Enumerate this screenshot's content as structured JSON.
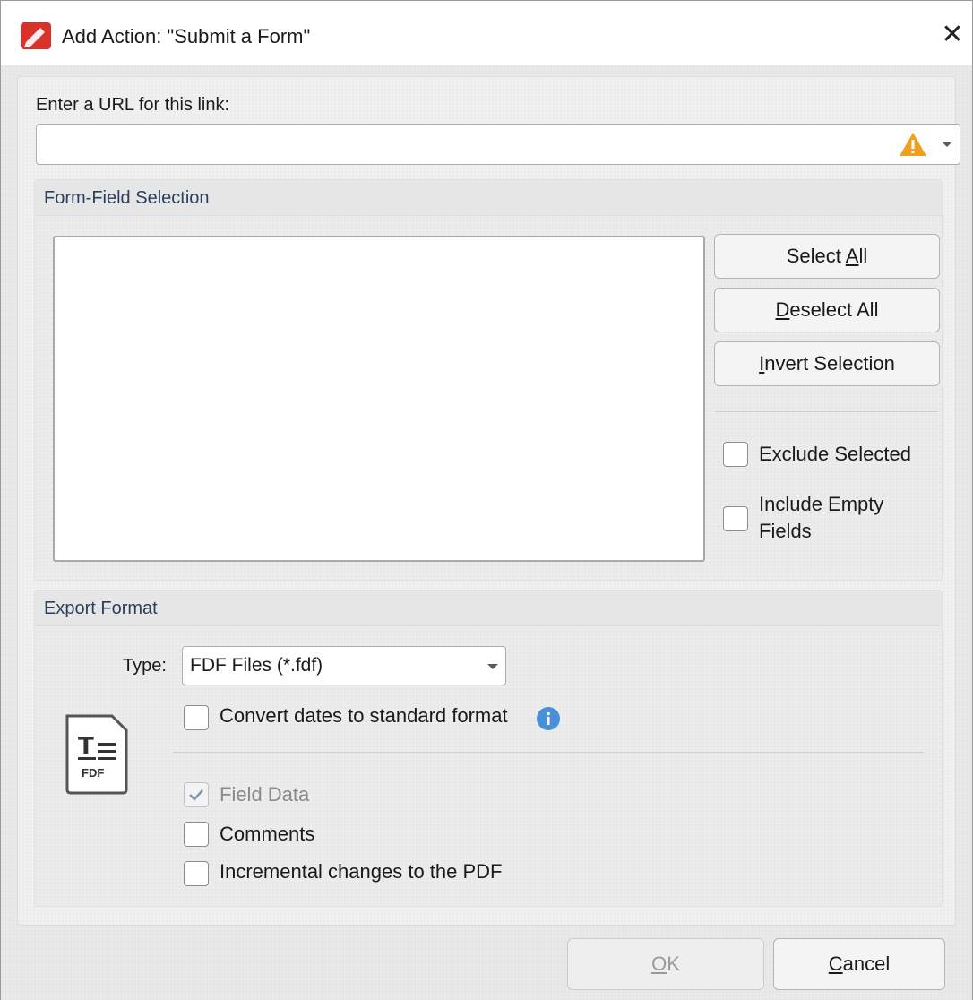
{
  "window": {
    "title": "Add Action: \"Submit a Form\"",
    "close_glyph": "✕"
  },
  "url": {
    "label": "Enter a URL for this link:",
    "value": "",
    "warning_icon": "warning-triangle-icon"
  },
  "form_field_selection": {
    "title": "Form-Field Selection",
    "items": [],
    "select_all": {
      "pre": "Select ",
      "key": "A",
      "post": "ll"
    },
    "deselect_all": {
      "pre": "",
      "key": "D",
      "post": "eselect All"
    },
    "invert_selection": {
      "pre": "",
      "key": "I",
      "post": "nvert Selection"
    },
    "exclude_selected": {
      "label": "Exclude Selected",
      "checked": false
    },
    "include_empty_fields": {
      "label_line1": "Include Empty",
      "label_line2": "Fields",
      "checked": false
    }
  },
  "export_format": {
    "title": "Export Format",
    "type_label": "Type:",
    "type_value": "FDF Files (*.fdf)",
    "convert_dates": {
      "label": "Convert dates to standard format",
      "checked": false
    },
    "format_icon_text": "FDF",
    "field_data": {
      "label": "Field Data",
      "checked": true,
      "disabled": true
    },
    "comments": {
      "label": "Comments",
      "checked": false
    },
    "incremental": {
      "label": "Incremental changes to the PDF",
      "checked": false
    }
  },
  "footer": {
    "ok": {
      "key": "O",
      "post": "K",
      "disabled": true
    },
    "cancel": {
      "key": "C",
      "post": "ancel"
    }
  },
  "colors": {
    "accent_red": "#d9322b",
    "warning_orange": "#f0a020",
    "info_blue": "#4a90d9",
    "group_header_text": "#2b3f5c"
  }
}
